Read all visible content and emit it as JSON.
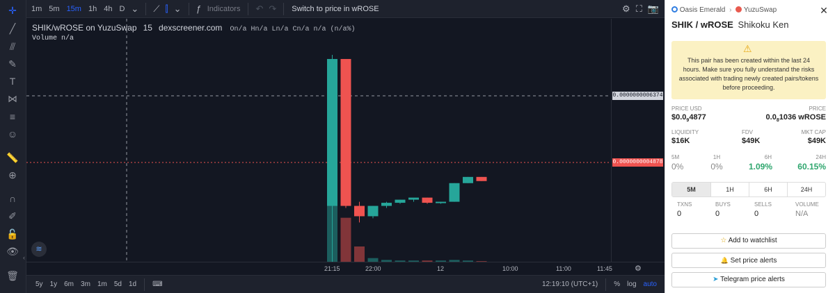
{
  "toolbar": {
    "timeframes": [
      "1m",
      "5m",
      "15m",
      "1h",
      "4h",
      "D"
    ],
    "active_timeframe": "15m",
    "indicators_label": "Indicators",
    "switch_label": "Switch to price in wROSE"
  },
  "legend": {
    "pair": "SHIK/wROSE on YuzuSwap",
    "interval": "15",
    "source": "dexscreener.com",
    "ohlc": "On/a Hn/a Ln/a Cn/a n/a (n/a%)",
    "volume": "Volume n/a"
  },
  "price_axis": {
    "tag_top": "0.0000000006374",
    "tag_current": "0.0000000004878"
  },
  "time_axis": [
    "21:15",
    "22:00",
    "12",
    "10:00",
    "11:00",
    "11:45"
  ],
  "bottom": {
    "ranges": [
      "5y",
      "1y",
      "6m",
      "3m",
      "1m",
      "5d",
      "1d"
    ],
    "clock": "12:19:10 (UTC+1)",
    "percent": "%",
    "log": "log",
    "auto": "auto"
  },
  "colors": {
    "up": "#26a69a",
    "down": "#ef5350",
    "accent": "#2962ff"
  },
  "chart_data": {
    "type": "candlestick",
    "title": "SHIK/wROSE on YuzuSwap",
    "xlabel": "",
    "ylabel": "",
    "candles": [
      {
        "o": 0.27,
        "h": 1.0,
        "l": 0.0,
        "c": 0.98,
        "dir": "up"
      },
      {
        "o": 0.98,
        "h": 0.98,
        "l": 0.26,
        "c": 0.27,
        "dir": "down"
      },
      {
        "o": 0.27,
        "h": 0.29,
        "l": 0.19,
        "c": 0.22,
        "dir": "down"
      },
      {
        "o": 0.22,
        "h": 0.27,
        "l": 0.21,
        "c": 0.27,
        "dir": "up"
      },
      {
        "o": 0.27,
        "h": 0.29,
        "l": 0.26,
        "c": 0.285,
        "dir": "up"
      },
      {
        "o": 0.285,
        "h": 0.3,
        "l": 0.28,
        "c": 0.3,
        "dir": "up"
      },
      {
        "o": 0.3,
        "h": 0.305,
        "l": 0.29,
        "c": 0.31,
        "dir": "up"
      },
      {
        "o": 0.31,
        "h": 0.31,
        "l": 0.28,
        "c": 0.285,
        "dir": "down"
      },
      {
        "o": 0.285,
        "h": 0.29,
        "l": 0.28,
        "c": 0.29,
        "dir": "up"
      },
      {
        "o": 0.29,
        "h": 0.38,
        "l": 0.29,
        "c": 0.38,
        "dir": "up"
      },
      {
        "o": 0.38,
        "h": 0.41,
        "l": 0.38,
        "c": 0.41,
        "dir": "up"
      },
      {
        "o": 0.41,
        "h": 0.41,
        "l": 0.39,
        "c": 0.39,
        "dir": "down"
      }
    ],
    "volumes": [
      1.0,
      0.72,
      0.25,
      0.06,
      0.03,
      0.02,
      0.02,
      0.02,
      0.02,
      0.03,
      0.02,
      0.01
    ]
  },
  "side": {
    "chain": "Oasis Emerald",
    "dex": "YuzuSwap",
    "pair_title": "SHIK / wROSE",
    "token_name": "Shikoku Ken",
    "warning": "This pair has been created within the last 24 hours. Make sure you fully understand the risks associated with trading newly created pairs/tokens before proceeding.",
    "price_usd_label": "PRICE USD",
    "price_usd_prefix": "$0.0",
    "price_usd_sub": "9",
    "price_usd_rest": "4877",
    "price_label": "PRICE",
    "price_prefix": "0.0",
    "price_sub": "8",
    "price_rest": "1036 wROSE",
    "liquidity_label": "LIQUIDITY",
    "liquidity": "$16K",
    "fdv_label": "FDV",
    "fdv": "$49K",
    "mcap_label": "MKT CAP",
    "mcap": "$49K",
    "changes": [
      {
        "label": "5M",
        "value": "0%"
      },
      {
        "label": "1H",
        "value": "0%"
      },
      {
        "label": "6H",
        "value": "1.09%"
      },
      {
        "label": "24H",
        "value": "60.15%"
      }
    ],
    "tabs": [
      "5M",
      "1H",
      "6H",
      "24H"
    ],
    "stats": [
      {
        "label": "TXNS",
        "value": "0"
      },
      {
        "label": "BUYS",
        "value": "0"
      },
      {
        "label": "SELLS",
        "value": "0"
      },
      {
        "label": "VOLUME",
        "value": "N/A"
      }
    ],
    "watchlist": "Add to watchlist",
    "alerts": "Set price alerts",
    "telegram": "Telegram price alerts"
  }
}
